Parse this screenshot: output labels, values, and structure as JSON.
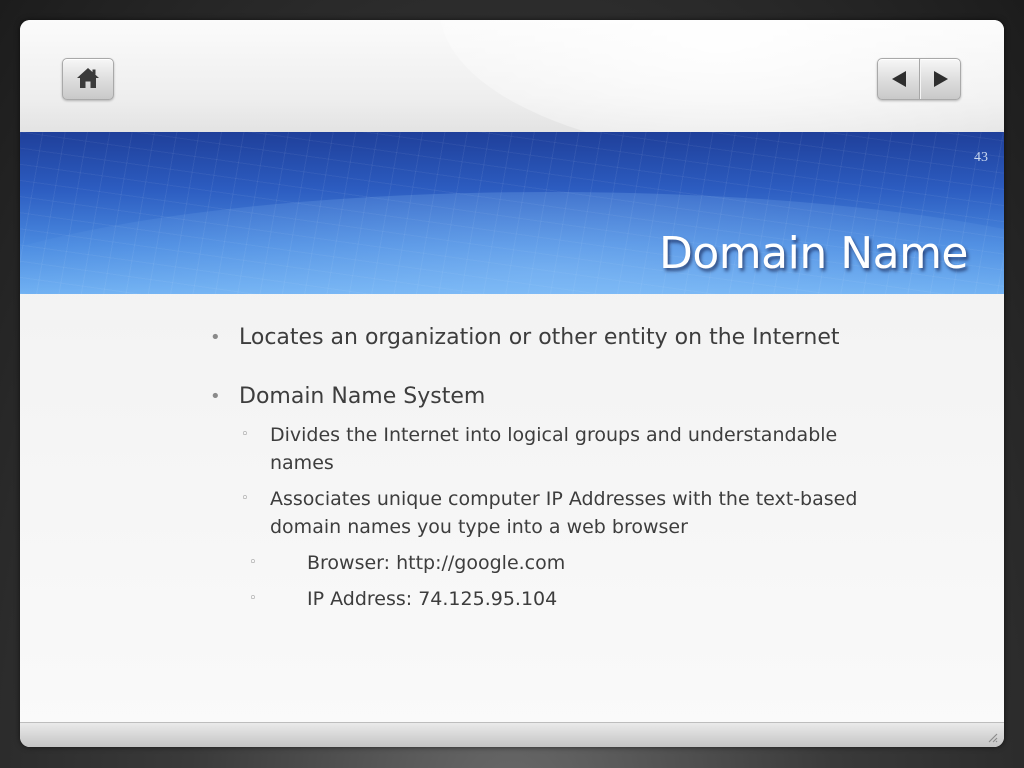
{
  "slide": {
    "number": "43",
    "title": "Domain Name"
  },
  "nav": {
    "home_icon": "home-icon",
    "prev_icon": "triangle-left-icon",
    "next_icon": "triangle-right-icon"
  },
  "bullets": [
    {
      "text": "Locates an organization or other entity on the Internet"
    },
    {
      "text": "Domain Name System"
    }
  ],
  "sub_bullets": [
    {
      "lines": [
        "Divides the Internet into logical groups and understandable",
        "names"
      ]
    },
    {
      "lines": [
        "Associates unique computer IP Addresses with the text-based",
        "domain names you type into a web browser"
      ]
    }
  ],
  "sub_sub_bullets": [
    {
      "text": "Browser: http://google.com"
    },
    {
      "text": "IP Address: 74.125.95.104"
    }
  ],
  "colors": {
    "header_dark": "#1f3f9a",
    "header_light": "#6fb0f2",
    "text": "#3d3d3d",
    "title": "#ffffff"
  }
}
